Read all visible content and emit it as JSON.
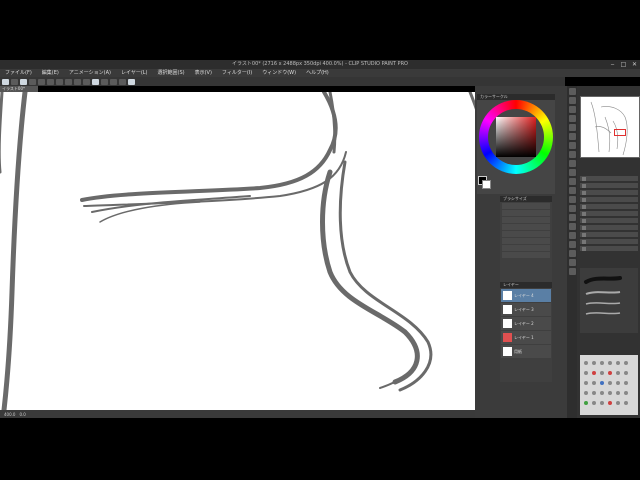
{
  "app": {
    "title": "イラスト00* (2716 x 2488px 350dpi 400.0%) - CLIP STUDIO PAINT PRO",
    "doc_tab": "イラスト00*"
  },
  "menu": [
    {
      "label": "ファイル(F)"
    },
    {
      "label": "編集(E)"
    },
    {
      "label": "アニメーション(A)"
    },
    {
      "label": "レイヤー(L)"
    },
    {
      "label": "選択範囲(S)"
    },
    {
      "label": "表示(V)"
    },
    {
      "label": "フィルター(I)"
    },
    {
      "label": "ウィンドウ(W)"
    },
    {
      "label": "ヘルプ(H)"
    }
  ],
  "window_controls": {
    "minimize": "‒",
    "maximize": "□",
    "close": "✕"
  },
  "panels": {
    "color_title": "カラーサークル",
    "brush_title": "ブラシサイズ",
    "layer_title": "レイヤー",
    "navigator_title": "ナビゲーター",
    "subtool_title": "サブツール"
  },
  "layers": [
    {
      "name": "レイヤー 4"
    },
    {
      "name": "レイヤー 3"
    },
    {
      "name": "レイヤー 2"
    },
    {
      "name": "レイヤー 1"
    },
    {
      "name": "用紙"
    }
  ],
  "statusbar": {
    "zoom": "400.0",
    "angle": "0.0"
  },
  "colors": {
    "accent_red": "#e03030",
    "main_color": "#000000",
    "sub_color": "#ffffff"
  }
}
